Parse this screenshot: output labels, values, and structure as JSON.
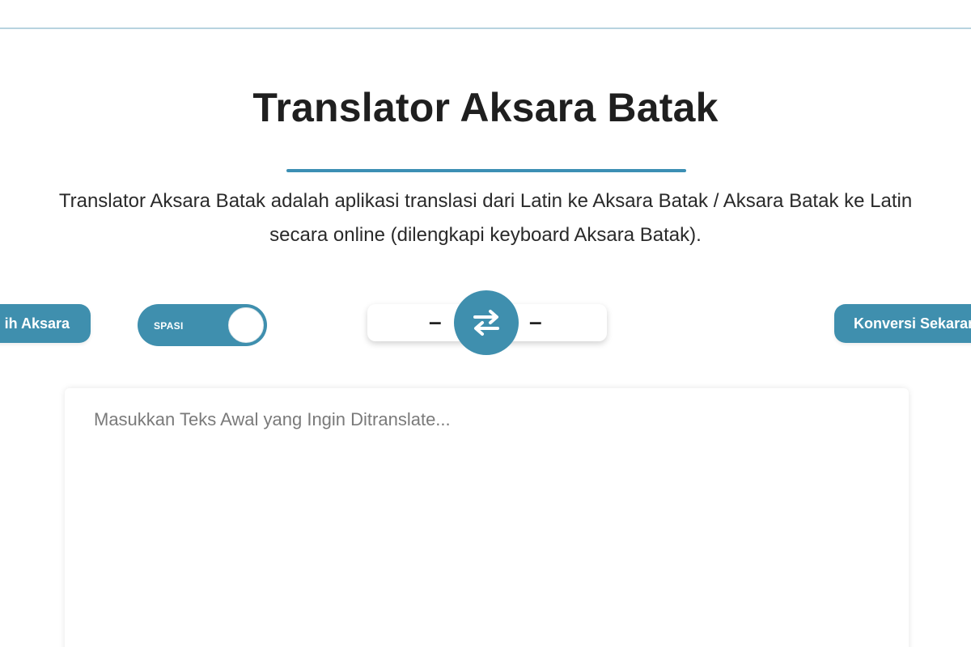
{
  "header": {
    "title": "Translator Aksara Batak"
  },
  "description": {
    "line1": "Translator Aksara Batak adalah aplikasi translasi dari Latin ke Aksara Batak / Aksara Batak ke Latin",
    "line2": "secara online (dilengkapi keyboard Aksara Batak)."
  },
  "controls": {
    "pilih_label": "ih Aksara",
    "toggle_label": "SPASI",
    "toggle_state": "on",
    "source_lang": "–",
    "target_lang": "–",
    "swap_icon": "swap-arrows-icon",
    "convert_label": "Konversi Sekarang"
  },
  "input": {
    "placeholder": "Masukkan Teks Awal yang Ingin Ditranslate...",
    "value": ""
  },
  "colors": {
    "accent": "#3f8fae",
    "underline": "#3c8fb4",
    "top_rule": "#b7d3df"
  }
}
